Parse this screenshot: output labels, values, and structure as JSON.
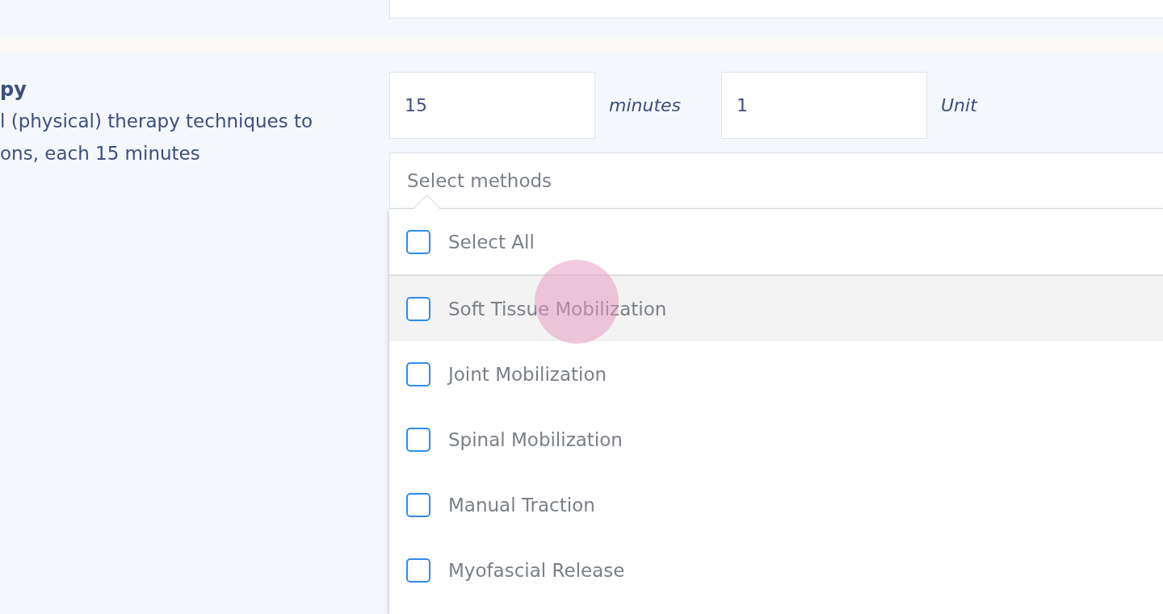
{
  "previous_section": {
    "kind": "blank-field"
  },
  "section": {
    "title_fragment": "py",
    "description_lines": [
      "l (physical) therapy techniques to",
      "ons, each 15 minutes"
    ],
    "duration": {
      "value": "15",
      "unit": "minutes"
    },
    "units": {
      "value": "1",
      "unit": "Unit"
    },
    "methods_select": {
      "placeholder": "Select methods",
      "expanded": true,
      "select_all": {
        "label": "Select All",
        "checked": false
      },
      "options": [
        {
          "label": "Soft Tissue Mobilization",
          "checked": false,
          "hovered": true
        },
        {
          "label": "Joint Mobilization",
          "checked": false,
          "hovered": false
        },
        {
          "label": "Spinal Mobilization",
          "checked": false,
          "hovered": false
        },
        {
          "label": "Manual Traction",
          "checked": false,
          "hovered": false
        },
        {
          "label": "Myofascial Release",
          "checked": false,
          "hovered": false
        }
      ]
    }
  },
  "touch_indicator": {
    "visible": true
  }
}
